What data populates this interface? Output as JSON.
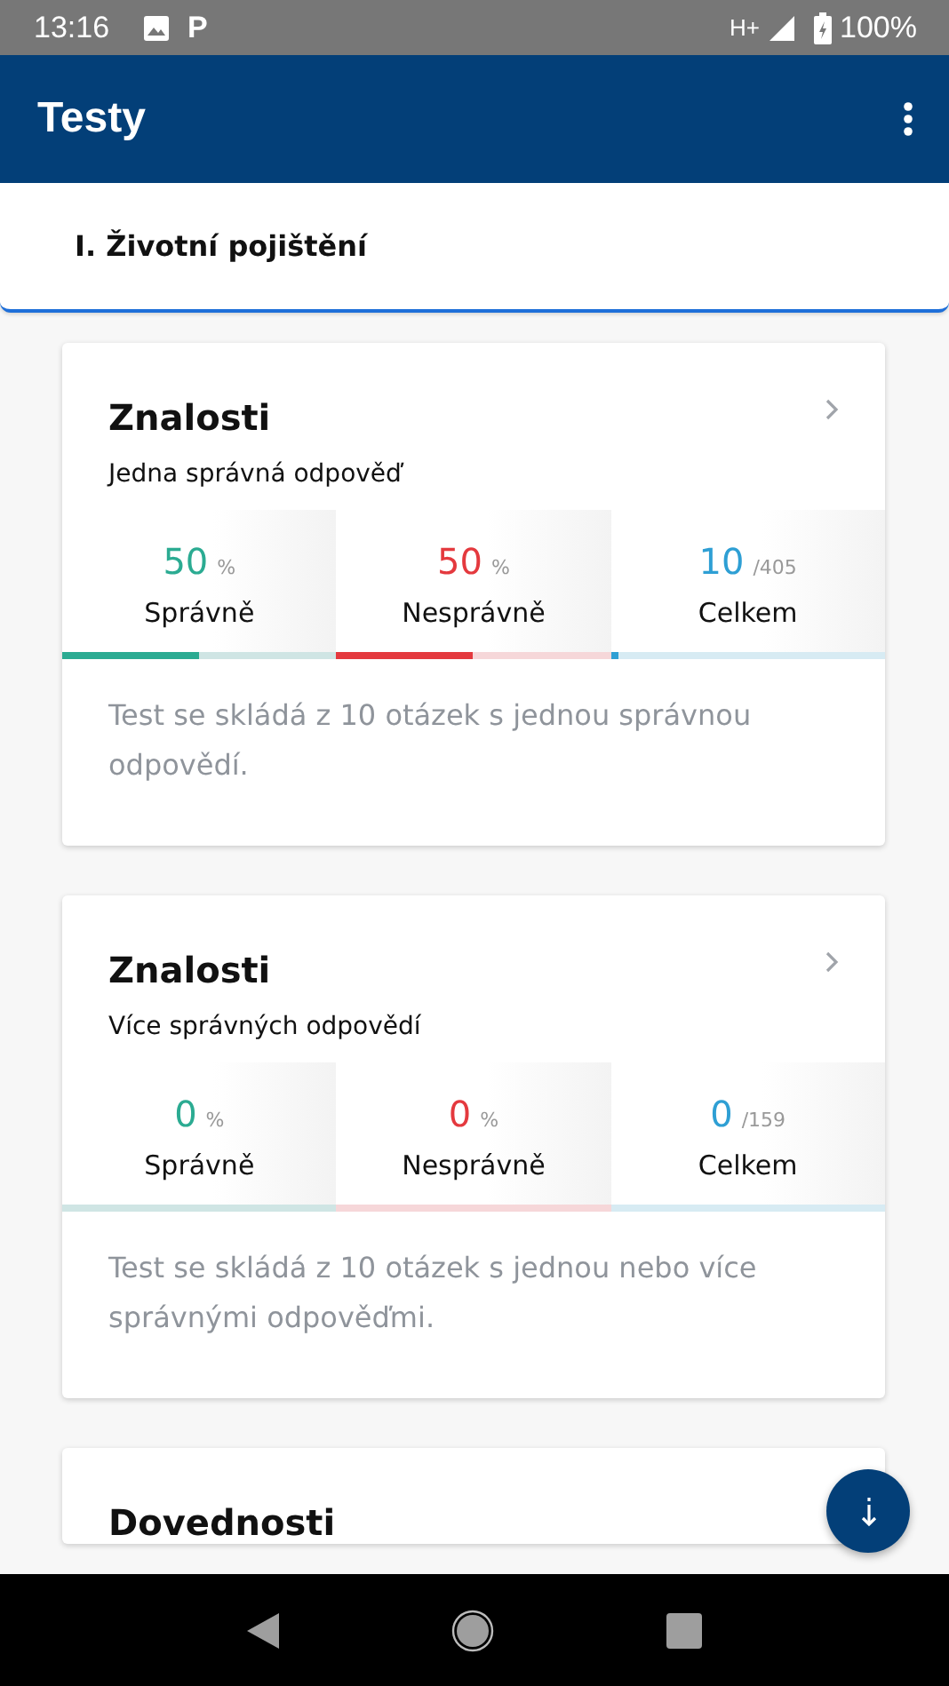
{
  "status_bar": {
    "time": "13:16",
    "notification_letter": "P",
    "network": "H+",
    "battery": "100%"
  },
  "app_bar": {
    "title": "Testy"
  },
  "section": {
    "title": "I. Životní pojištění"
  },
  "cards": [
    {
      "title": "Znalosti",
      "subtitle": "Jedna správná odpověď",
      "stats": [
        {
          "kind": "correct",
          "value": "50",
          "unit": "%",
          "label": "Správně",
          "level": 0.5
        },
        {
          "kind": "incorrect",
          "value": "50",
          "unit": "%",
          "label": "Nesprávně",
          "level": 0.5
        },
        {
          "kind": "total",
          "value": "10",
          "unit": "/405",
          "label": "Celkem",
          "level": 0.025
        }
      ],
      "description": "Test se skládá z 10 otázek s jednou správnou odpovědí."
    },
    {
      "title": "Znalosti",
      "subtitle": "Více správných odpovědí",
      "stats": [
        {
          "kind": "correct",
          "value": "0",
          "unit": "%",
          "label": "Správně",
          "level": 0
        },
        {
          "kind": "incorrect",
          "value": "0",
          "unit": "%",
          "label": "Nesprávně",
          "level": 0
        },
        {
          "kind": "total",
          "value": "0",
          "unit": "/159",
          "label": "Celkem",
          "level": 0
        }
      ],
      "description": "Test se skládá z 10 otázek s jednou nebo více správnými odpověďmi."
    },
    {
      "title": "Dovednosti"
    }
  ]
}
